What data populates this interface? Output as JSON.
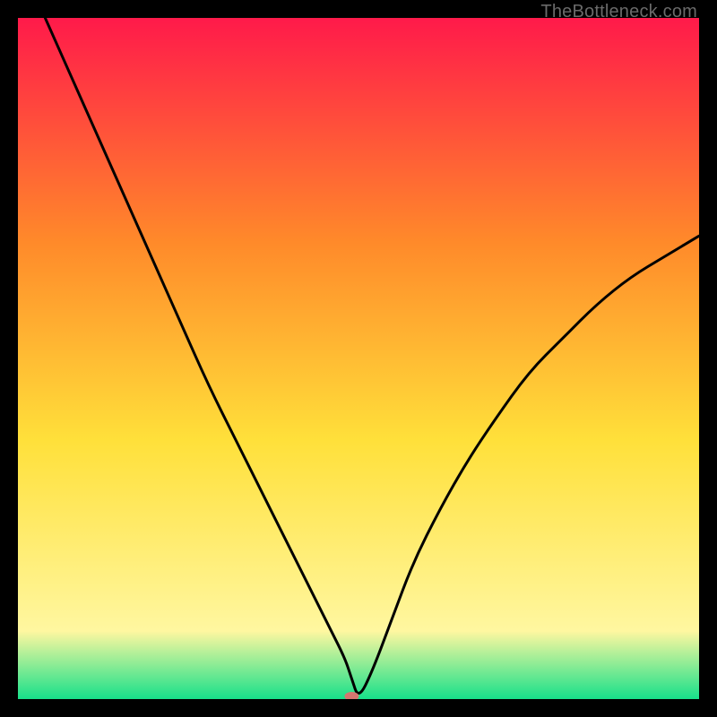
{
  "watermark": "TheBottleneck.com",
  "chart_data": {
    "type": "line",
    "title": "",
    "xlabel": "",
    "ylabel": "",
    "xlim": [
      0,
      100
    ],
    "ylim": [
      0,
      100
    ],
    "background_gradient": {
      "top": "#ff1a4a",
      "mid_upper": "#ff8a2a",
      "mid": "#ffe03a",
      "lower": "#fff7a0",
      "bottom": "#17e08a"
    },
    "series": [
      {
        "name": "bottleneck-curve",
        "type": "line",
        "color": "#000000",
        "x": [
          4,
          8,
          12,
          16,
          20,
          24,
          28,
          32,
          36,
          40,
          44,
          46,
          48,
          49,
          50,
          52,
          55,
          58,
          62,
          66,
          70,
          75,
          80,
          85,
          90,
          95,
          100
        ],
        "values": [
          100,
          91,
          82,
          73,
          64,
          55,
          46,
          38,
          30,
          22,
          14,
          10,
          6,
          3,
          0,
          4,
          12,
          20,
          28,
          35,
          41,
          48,
          53,
          58,
          62,
          65,
          68
        ]
      },
      {
        "name": "optimal-marker",
        "type": "scatter",
        "color": "#d6766f",
        "x": [
          49
        ],
        "values": [
          0.4
        ]
      }
    ]
  }
}
